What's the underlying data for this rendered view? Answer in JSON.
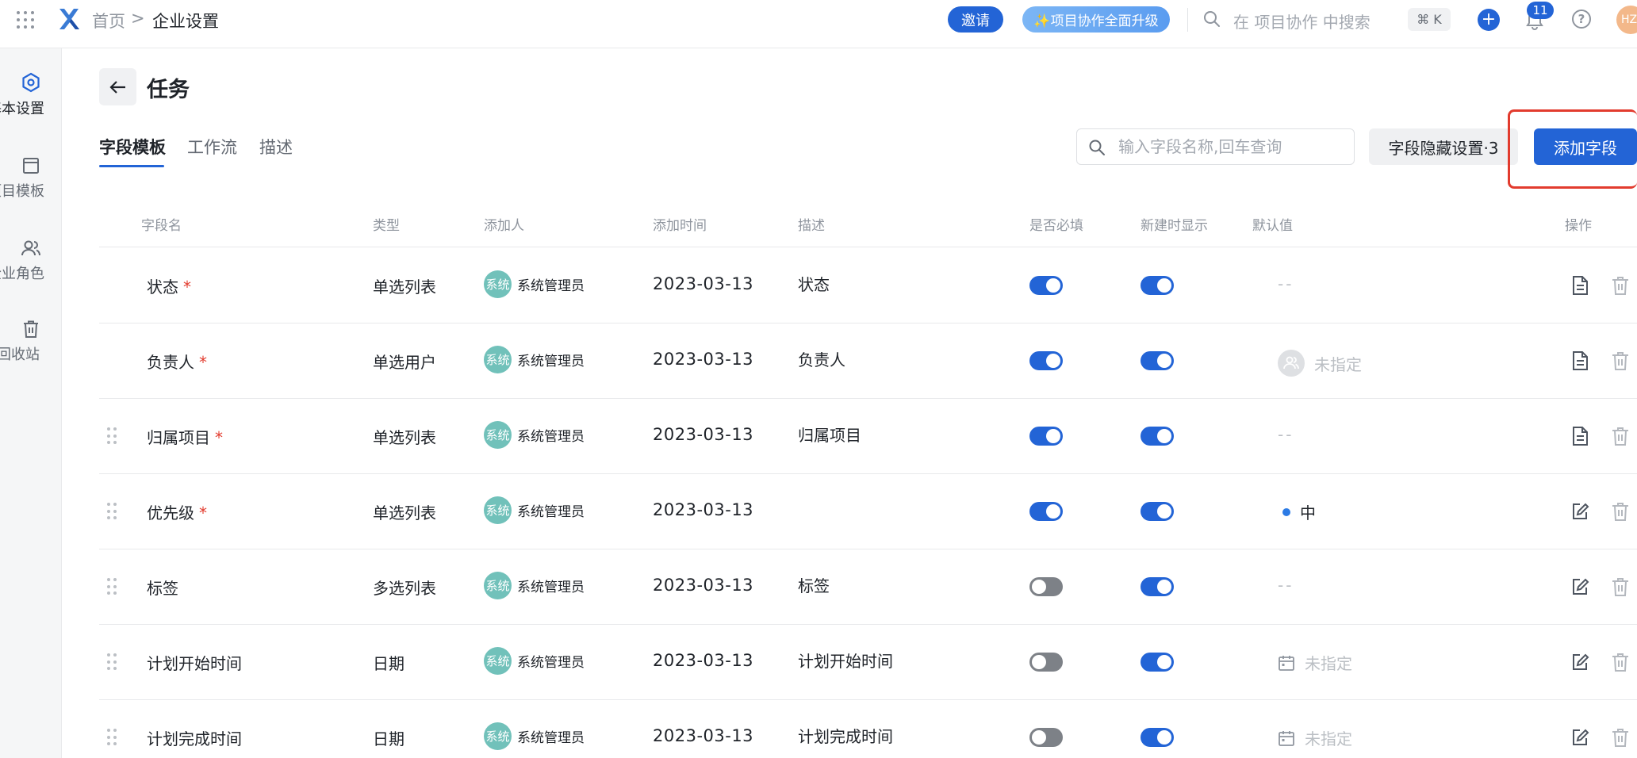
{
  "topbar": {
    "breadcrumb_home": "首页",
    "breadcrumb_sep": ">",
    "breadcrumb_current": "企业设置",
    "invite_label": "邀请",
    "upgrade_label": "✨项目协作全面升级",
    "search_placeholder": "在 项目协作 中搜索",
    "shortcut": "⌘ K",
    "plus": "+",
    "notification_count": "11",
    "help": "?",
    "avatar_text": "HZ"
  },
  "sidebar": {
    "items": [
      {
        "label": "基本设置",
        "icon": "settings-hex-icon",
        "active": true
      },
      {
        "label": "项目模板",
        "icon": "template-icon",
        "active": false
      },
      {
        "label": "企业角色",
        "icon": "users-icon",
        "active": false
      },
      {
        "label": "回收站",
        "icon": "trash-icon",
        "active": false
      }
    ]
  },
  "page": {
    "title": "任务",
    "tabs": [
      {
        "label": "字段模板",
        "active": true
      },
      {
        "label": "工作流",
        "active": false
      },
      {
        "label": "描述",
        "active": false
      }
    ],
    "search_placeholder": "输入字段名称,回车查询",
    "hide_settings_label": "字段隐藏设置·3",
    "add_field_label": "添加字段"
  },
  "table": {
    "headers": {
      "name": "字段名",
      "type": "类型",
      "adder": "添加人",
      "time": "添加时间",
      "desc": "描述",
      "required": "是否必填",
      "show_on_create": "新建时显示",
      "default": "默认值",
      "actions": "操作"
    },
    "rows": [
      {
        "name": "状态",
        "required_mark": "*",
        "type": "单选列表",
        "adder_avatar": "系统",
        "adder": "系统管理员",
        "date": "2023-03-13",
        "desc": "状态",
        "required": true,
        "show": true,
        "default": "--",
        "default_kind": "empty",
        "action_icon": "document-icon",
        "draggable": false
      },
      {
        "name": "负责人",
        "required_mark": "*",
        "type": "单选用户",
        "adder_avatar": "系统",
        "adder": "系统管理员",
        "date": "2023-03-13",
        "desc": "负责人",
        "required": true,
        "show": true,
        "default": "未指定",
        "default_kind": "user",
        "action_icon": "document-icon",
        "draggable": false
      },
      {
        "name": "归属项目",
        "required_mark": "*",
        "type": "单选列表",
        "adder_avatar": "系统",
        "adder": "系统管理员",
        "date": "2023-03-13",
        "desc": "归属项目",
        "required": true,
        "show": true,
        "default": "--",
        "default_kind": "empty",
        "action_icon": "document-icon",
        "draggable": true
      },
      {
        "name": "优先级",
        "required_mark": "*",
        "type": "单选列表",
        "adder_avatar": "系统",
        "adder": "系统管理员",
        "date": "2023-03-13",
        "desc": "",
        "required": true,
        "show": true,
        "default": "中",
        "default_kind": "dot",
        "action_icon": "edit-icon",
        "draggable": true
      },
      {
        "name": "标签",
        "required_mark": "",
        "type": "多选列表",
        "adder_avatar": "系统",
        "adder": "系统管理员",
        "date": "2023-03-13",
        "desc": "标签",
        "required": false,
        "show": true,
        "default": "--",
        "default_kind": "empty",
        "action_icon": "edit-icon",
        "draggable": true
      },
      {
        "name": "计划开始时间",
        "required_mark": "",
        "type": "日期",
        "adder_avatar": "系统",
        "adder": "系统管理员",
        "date": "2023-03-13",
        "desc": "计划开始时间",
        "required": false,
        "show": true,
        "default": "未指定",
        "default_kind": "calendar",
        "action_icon": "edit-icon",
        "draggable": true
      },
      {
        "name": "计划完成时间",
        "required_mark": "",
        "type": "日期",
        "adder_avatar": "系统",
        "adder": "系统管理员",
        "date": "2023-03-13",
        "desc": "计划完成时间",
        "required": false,
        "show": true,
        "default": "未指定",
        "default_kind": "calendar",
        "action_icon": "edit-icon",
        "draggable": true
      }
    ]
  },
  "colors": {
    "primary": "#2364d6",
    "highlight_border": "#e23b2e",
    "avatar_bg": "#71c1ba",
    "toggle_off": "#7d8187"
  }
}
